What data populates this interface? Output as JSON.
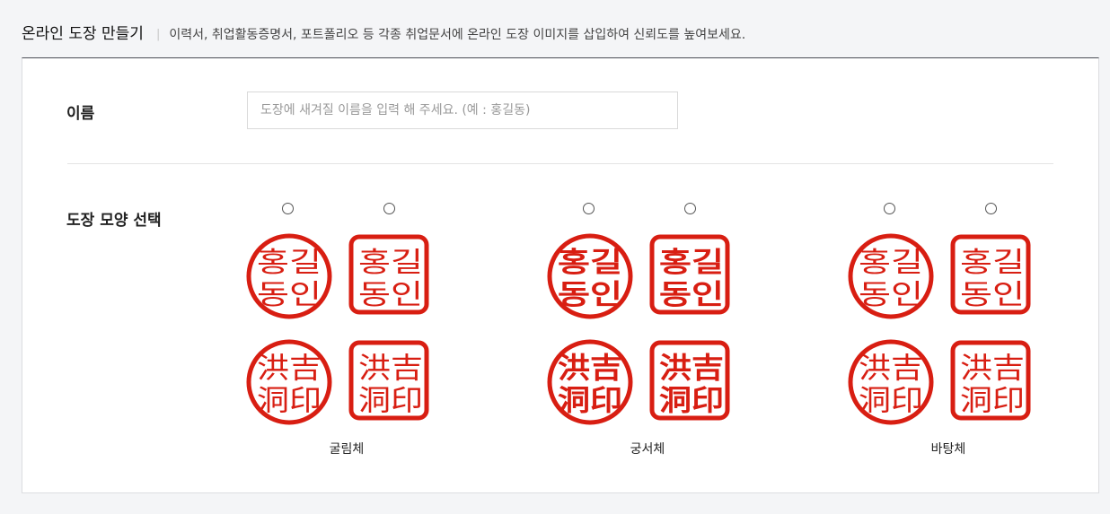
{
  "header": {
    "title": "온라인 도장 만들기",
    "separator": "|",
    "description": "이력서, 취업활동증명서, 포트폴리오 등 각종 취업문서에 온라인 도장 이미지를 삽입하여 신뢰도를 높여보세요."
  },
  "name_field": {
    "label": "이름",
    "placeholder": "도장에 새겨질 이름을 입력 해 주세요. (예 : 홍길동)",
    "value": ""
  },
  "shape_select": {
    "label": "도장 모양 선택",
    "stamp_color": "#d81e12",
    "groups": [
      {
        "font_label": "굴림체",
        "korean_line1": "홍길",
        "korean_line2": "동인",
        "hanja_line1": "洪吉",
        "hanja_line2": "洞印"
      },
      {
        "font_label": "궁서체",
        "korean_line1": "홍길",
        "korean_line2": "동인",
        "hanja_line1": "洪吉",
        "hanja_line2": "洞印"
      },
      {
        "font_label": "바탕체",
        "korean_line1": "홍길",
        "korean_line2": "동인",
        "hanja_line1": "洪吉",
        "hanja_line2": "洞印"
      }
    ]
  }
}
